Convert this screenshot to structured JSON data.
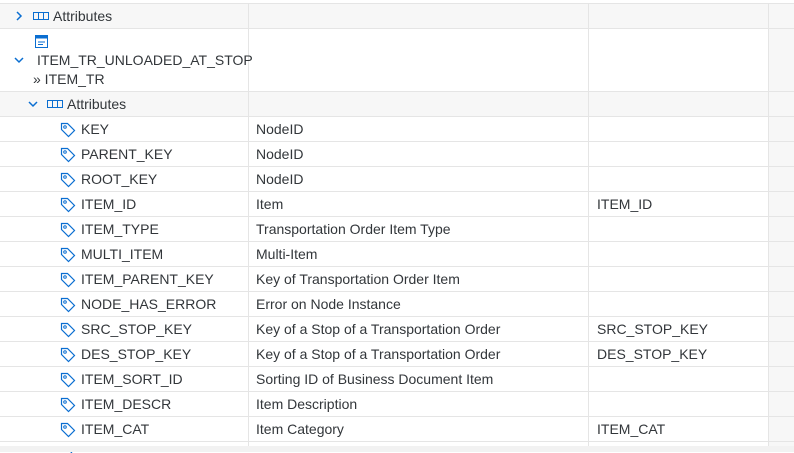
{
  "group_attributes_1": {
    "label": "Attributes",
    "expander": "chevron-right-icon",
    "icon": "attributes-icon"
  },
  "association": {
    "name": "ITEM_TR_UNLOADED_AT_STOP",
    "target": "» ITEM_TR",
    "expander": "chevron-down-icon",
    "icon": "association-node-icon"
  },
  "group_attributes_2": {
    "label": "Attributes",
    "expander": "chevron-down-icon",
    "icon": "attributes-icon"
  },
  "attributes": [
    {
      "name": "KEY",
      "description": "NodeID",
      "field": "",
      "icon": "tag-icon"
    },
    {
      "name": "PARENT_KEY",
      "description": "NodeID",
      "field": "",
      "icon": "tag-icon"
    },
    {
      "name": "ROOT_KEY",
      "description": "NodeID",
      "field": "",
      "icon": "tag-icon"
    },
    {
      "name": "ITEM_ID",
      "description": "Item",
      "field": "ITEM_ID",
      "icon": "tag-icon"
    },
    {
      "name": "ITEM_TYPE",
      "description": "Transportation Order Item Type",
      "field": "",
      "icon": "tag-icon"
    },
    {
      "name": "MULTI_ITEM",
      "description": "Multi-Item",
      "field": "",
      "icon": "tag-icon"
    },
    {
      "name": "ITEM_PARENT_KEY",
      "description": "Key of Transportation Order Item",
      "field": "",
      "icon": "tag-icon"
    },
    {
      "name": "NODE_HAS_ERROR",
      "description": "Error on Node Instance",
      "field": "",
      "icon": "tag-icon"
    },
    {
      "name": "SRC_STOP_KEY",
      "description": "Key of a Stop of a Transportation Order",
      "field": "SRC_STOP_KEY",
      "icon": "tag-icon"
    },
    {
      "name": "DES_STOP_KEY",
      "description": "Key of a Stop of a Transportation Order",
      "field": "DES_STOP_KEY",
      "icon": "tag-icon"
    },
    {
      "name": "ITEM_SORT_ID",
      "description": "Sorting ID of Business Document Item",
      "field": "",
      "icon": "tag-icon"
    },
    {
      "name": "ITEM_DESCR",
      "description": "Item Description",
      "field": "",
      "icon": "tag-icon"
    },
    {
      "name": "ITEM_CAT",
      "description": "Item Category",
      "field": "ITEM_CAT",
      "icon": "tag-icon"
    }
  ]
}
